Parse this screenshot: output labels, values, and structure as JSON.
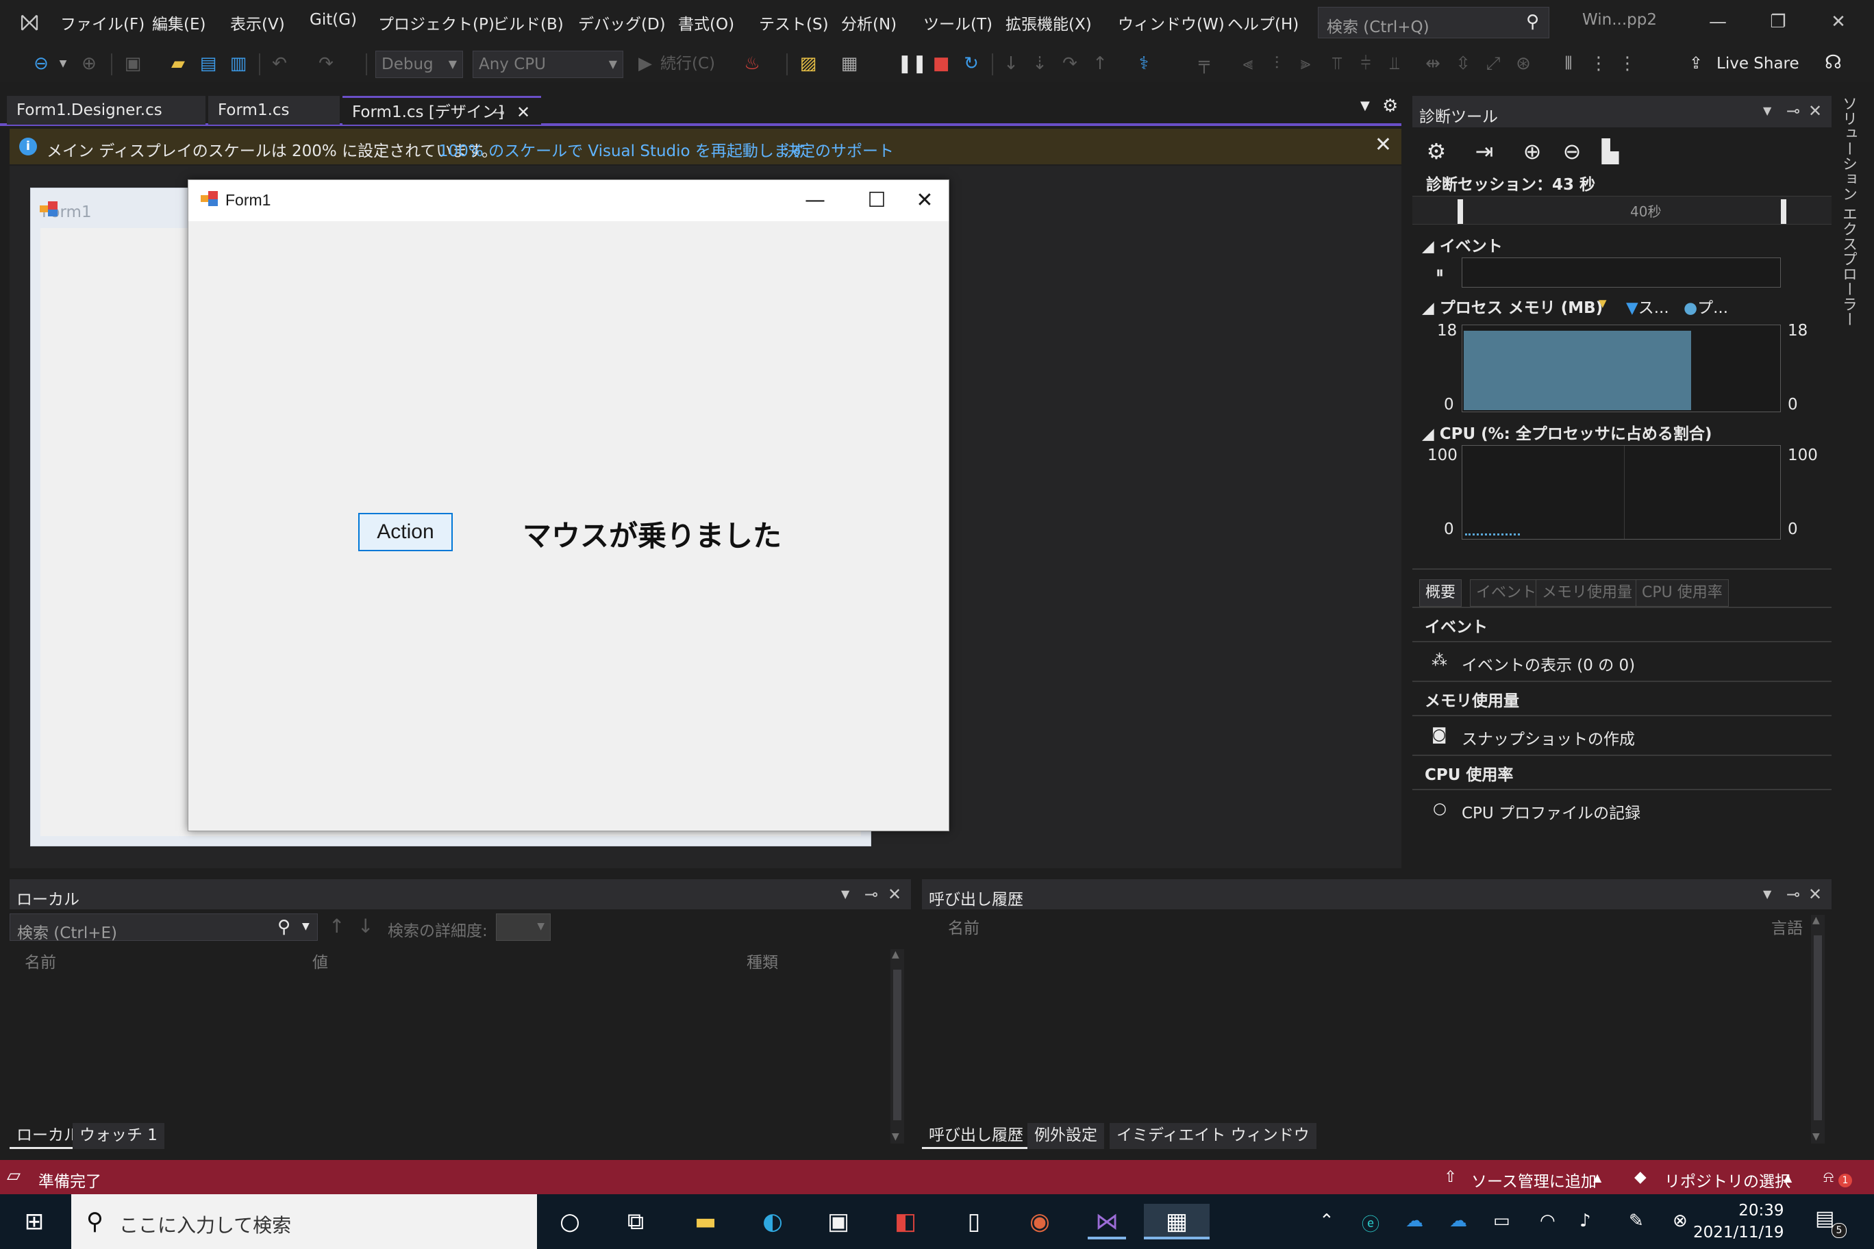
{
  "menubar": {
    "items": [
      "ファイル(F)",
      "編集(E)",
      "表示(V)",
      "Git(G)",
      "プロジェクト(P)",
      "ビルド(B)",
      "デバッグ(D)",
      "書式(O)",
      "テスト(S)",
      "分析(N)",
      "ツール(T)",
      "拡張機能(X)",
      "ウィンドウ(W)",
      "ヘルプ(H)"
    ],
    "search_placeholder": "検索 (Ctrl+Q)",
    "window_title": "Win...pp2"
  },
  "toolbar": {
    "config": "Debug",
    "platform": "Any CPU",
    "continue_label": "続行(C)",
    "live_share": "Live Share"
  },
  "doc_tabs": [
    "Form1.Designer.cs",
    "Form1.cs",
    "Form1.cs [デザイン]"
  ],
  "infobar": {
    "message": "メイン ディスプレイのスケールは 200% に設定されています。",
    "link_restart": "100% のスケールで Visual Studio を再起動します",
    "link_support": "決定のサポート"
  },
  "designer": {
    "background_form_title": "Form1",
    "form_title": "Form1",
    "action_button": "Action",
    "label_text": "マウスが乗りました"
  },
  "diag": {
    "title": "診断ツール",
    "session": "診断セッション：43 秒",
    "timeline_marker": "40秒",
    "events_header": "イベント",
    "memory_header": "プロセス メモリ (MB)",
    "memory_legend_1": "ス...",
    "memory_legend_2": "プ...",
    "memory_max": "18",
    "memory_min": "0",
    "cpu_header": "CPU (%: 全プロセッサに占める割合)",
    "cpu_max": "100",
    "cpu_min": "0",
    "tabs": [
      "概要",
      "イベント",
      "メモリ使用量",
      "CPU 使用率"
    ],
    "sections": {
      "events_title": "イベント",
      "events_item": "イベントの表示 (0 の 0)",
      "memory_title": "メモリ使用量",
      "memory_item": "スナップショットの作成",
      "cpu_title": "CPU 使用率",
      "cpu_item": "CPU プロファイルの記録"
    }
  },
  "solution_explorer_tab": "ソリューション エクスプローラー",
  "locals": {
    "title": "ローカル",
    "search_placeholder": "検索 (Ctrl+E)",
    "search_depth_label": "検索の詳細度:",
    "columns": [
      "名前",
      "値",
      "種類"
    ],
    "tabs": [
      "ローカル",
      "ウォッチ 1"
    ]
  },
  "callstack": {
    "title": "呼び出し履歴",
    "columns": [
      "名前",
      "言語"
    ],
    "tabs": [
      "呼び出し履歴",
      "例外設定",
      "イミディエイト ウィンドウ"
    ]
  },
  "statusbar": {
    "ready": "準備完了",
    "source_control": "ソース管理に追加",
    "repository": "リポジトリの選択",
    "notification_count": "1"
  },
  "taskbar": {
    "search_placeholder": "ここに入力して検索",
    "time": "20:39",
    "date": "2021/11/19",
    "notification_badge": "5"
  },
  "colors": {
    "accent": "#6a4fc8",
    "status_bar": "#8a1d30",
    "info_bar": "#3b331c",
    "memory_fill": "#4f7a91"
  }
}
